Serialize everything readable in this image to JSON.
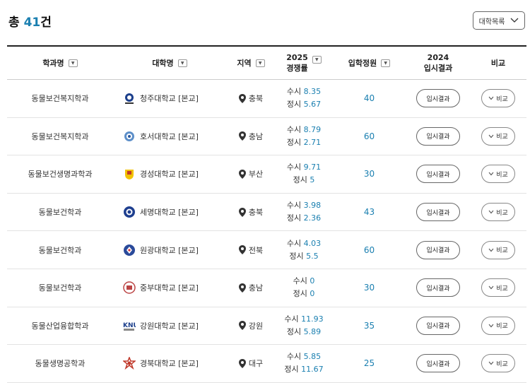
{
  "summary": {
    "prefix": "총 ",
    "count": "41",
    "suffix": "건"
  },
  "university_select": {
    "label": "대학목록"
  },
  "header": {
    "department": "학과명",
    "university": "대학명",
    "region": "지역",
    "year": "2025",
    "competition": "경쟁률",
    "quota": "입학정원",
    "result_year": "2024",
    "result": "입시결과",
    "compare": "비교"
  },
  "labels": {
    "susi": "수시",
    "jeongsi": "정시",
    "result_button": "입시결과",
    "compare_button": "비교"
  },
  "rows": [
    {
      "department": "동물보건복지학과",
      "university": "청주대학교 [본교]",
      "region": "충북",
      "susi": "8.35",
      "jeongsi": "5.67",
      "quota": "40"
    },
    {
      "department": "동물보건복지학과",
      "university": "호서대학교 [본교]",
      "region": "충남",
      "susi": "8.79",
      "jeongsi": "2.71",
      "quota": "60"
    },
    {
      "department": "동물보건생명과학과",
      "university": "경성대학교 [본교]",
      "region": "부산",
      "susi": "9.71",
      "jeongsi": "5",
      "quota": "30"
    },
    {
      "department": "동물보건학과",
      "university": "세명대학교 [본교]",
      "region": "충북",
      "susi": "3.98",
      "jeongsi": "2.36",
      "quota": "43"
    },
    {
      "department": "동물보건학과",
      "university": "원광대학교 [본교]",
      "region": "전북",
      "susi": "4.03",
      "jeongsi": "5.5",
      "quota": "60"
    },
    {
      "department": "동물보건학과",
      "university": "중부대학교 [본교]",
      "region": "충남",
      "susi": "0",
      "jeongsi": "0",
      "quota": "30"
    },
    {
      "department": "동물산업융합학과",
      "university": "강원대학교 [본교]",
      "region": "강원",
      "susi": "11.93",
      "jeongsi": "5.89",
      "quota": "35"
    },
    {
      "department": "동물생명공학과",
      "university": "경북대학교 [본교]",
      "region": "대구",
      "susi": "5.85",
      "jeongsi": "11.67",
      "quota": "25"
    }
  ],
  "colors": {
    "accent": "#1a7fb0",
    "border": "#666666",
    "header_rule": "#222222"
  },
  "icons": {
    "region": "map-pin-icon",
    "compare": "chevron-down-icon",
    "select": "chevron-down-icon",
    "sort": "sort-dropdown-icon"
  }
}
